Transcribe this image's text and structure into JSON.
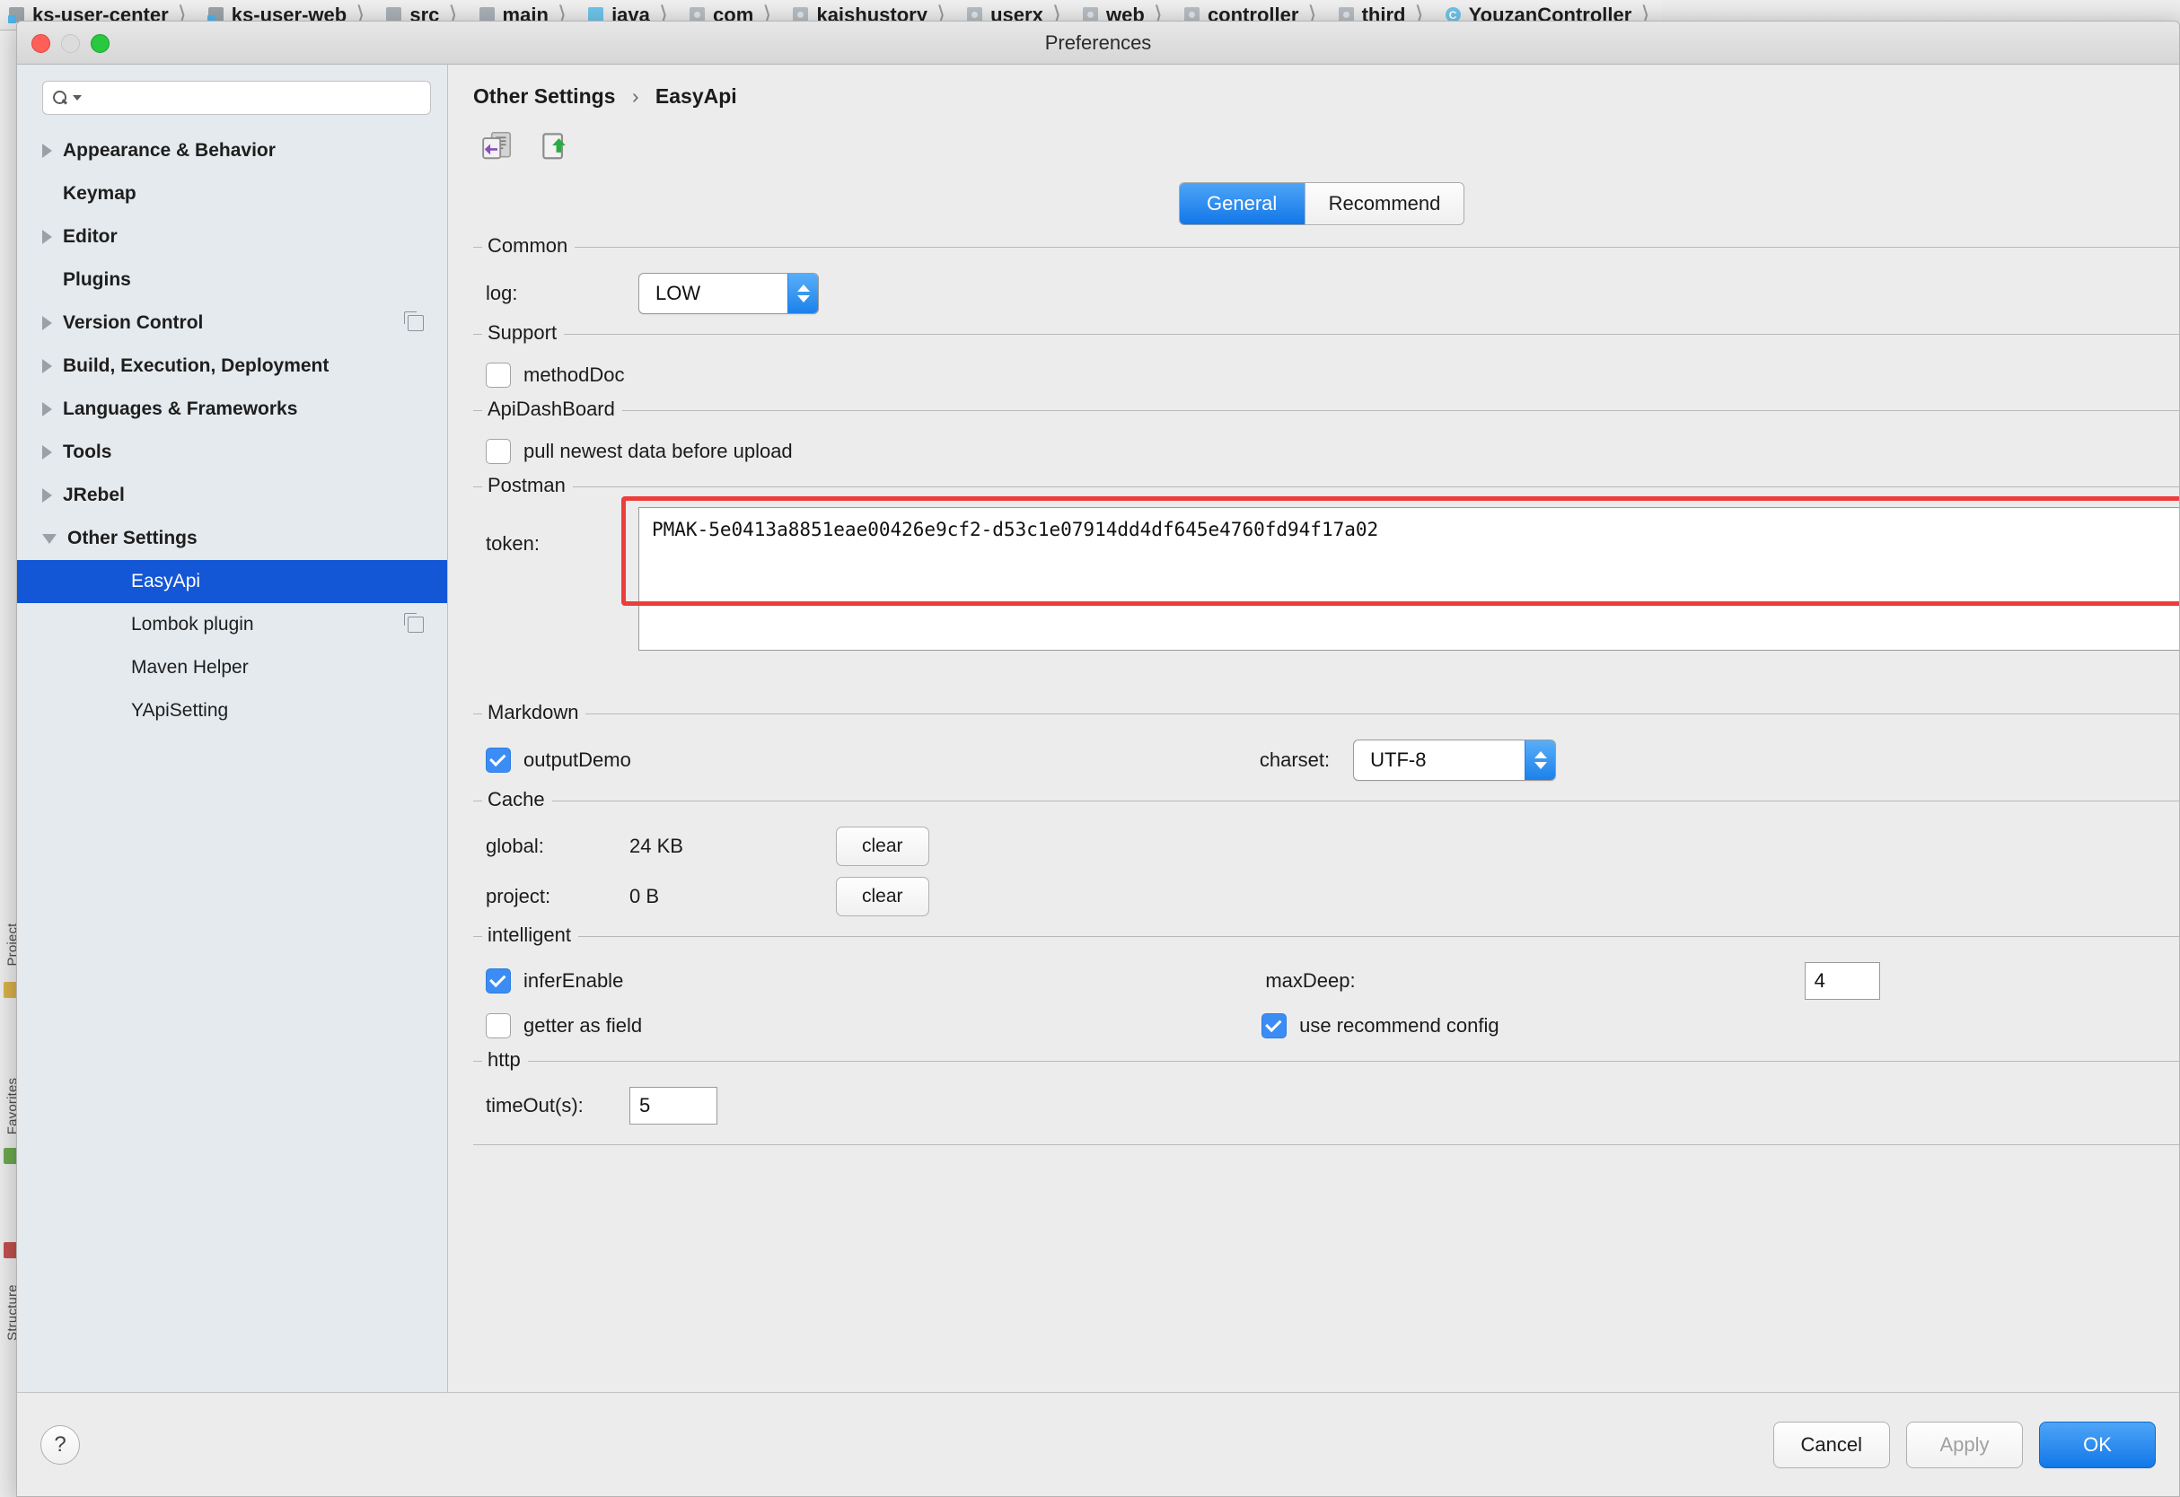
{
  "ide": {
    "breadcrumbs": [
      {
        "label": "ks-user-center",
        "icon": "project-icon"
      },
      {
        "label": "ks-user-web",
        "icon": "module-icon"
      },
      {
        "label": "src",
        "icon": "folder-icon"
      },
      {
        "label": "main",
        "icon": "folder-icon"
      },
      {
        "label": "java",
        "icon": "source-root-icon"
      },
      {
        "label": "com",
        "icon": "package-icon"
      },
      {
        "label": "kaishustory",
        "icon": "package-icon"
      },
      {
        "label": "userx",
        "icon": "package-icon"
      },
      {
        "label": "web",
        "icon": "package-icon"
      },
      {
        "label": "controller",
        "icon": "package-icon"
      },
      {
        "label": "third",
        "icon": "package-icon"
      },
      {
        "label": "YouzanController",
        "icon": "class-icon",
        "icon_glyph": "C"
      }
    ],
    "tool_strip": [
      "Project",
      "Favorites",
      "Structure"
    ]
  },
  "window": {
    "title": "Preferences",
    "traffic_lights": [
      "close-button",
      "minimize-button",
      "zoom-button"
    ]
  },
  "sidebar": {
    "search": {
      "value": "",
      "placeholder": "",
      "icon": "search-icon"
    },
    "items": [
      {
        "label": "Appearance & Behavior",
        "level": "top",
        "arrow": "collapsed",
        "selected": false,
        "badge": false
      },
      {
        "label": "Keymap",
        "level": "top",
        "arrow": "none",
        "selected": false,
        "badge": false
      },
      {
        "label": "Editor",
        "level": "top",
        "arrow": "collapsed",
        "selected": false,
        "badge": false
      },
      {
        "label": "Plugins",
        "level": "top",
        "arrow": "none",
        "selected": false,
        "badge": false
      },
      {
        "label": "Version Control",
        "level": "top",
        "arrow": "collapsed",
        "selected": false,
        "badge": true
      },
      {
        "label": "Build, Execution, Deployment",
        "level": "top",
        "arrow": "collapsed",
        "selected": false,
        "badge": false
      },
      {
        "label": "Languages & Frameworks",
        "level": "top",
        "arrow": "collapsed",
        "selected": false,
        "badge": false
      },
      {
        "label": "Tools",
        "level": "top",
        "arrow": "collapsed",
        "selected": false,
        "badge": false
      },
      {
        "label": "JRebel",
        "level": "top",
        "arrow": "collapsed",
        "selected": false,
        "badge": false
      },
      {
        "label": "Other Settings",
        "level": "top",
        "arrow": "expanded",
        "selected": false,
        "badge": false
      },
      {
        "label": "EasyApi",
        "level": "child",
        "arrow": "none",
        "selected": true,
        "badge": false
      },
      {
        "label": "Lombok plugin",
        "level": "child",
        "arrow": "none",
        "selected": false,
        "badge": true
      },
      {
        "label": "Maven Helper",
        "level": "child",
        "arrow": "none",
        "selected": false,
        "badge": false
      },
      {
        "label": "YApiSetting",
        "level": "child",
        "arrow": "none",
        "selected": false,
        "badge": false
      }
    ]
  },
  "content": {
    "breadcrumb": {
      "parent": "Other Settings",
      "separator": "›",
      "current": "EasyApi"
    },
    "toolbar": [
      {
        "name": "import-settings-button",
        "icon": "import-icon"
      },
      {
        "name": "export-settings-button",
        "icon": "export-icon"
      }
    ],
    "tabs": [
      {
        "label": "General",
        "active": true
      },
      {
        "label": "Recommend",
        "active": false
      }
    ],
    "groups": {
      "common": {
        "legend": "Common",
        "log_label": "log:",
        "log_value": "LOW"
      },
      "support": {
        "legend": "Support",
        "method_doc_label": "methodDoc",
        "method_doc_checked": false
      },
      "api_dashboard": {
        "legend": "ApiDashBoard",
        "pull_label": "pull newest data before upload",
        "pull_checked": false
      },
      "postman": {
        "legend": "Postman",
        "token_label": "token:",
        "token_value": "PMAK-5e0413a8851eae00426e9cf2-d53c1e07914dd4df645e4760fd94f17a02",
        "highlight_color": "#f03b3b"
      },
      "markdown": {
        "legend": "Markdown",
        "output_demo_label": "outputDemo",
        "output_demo_checked": true,
        "charset_label": "charset:",
        "charset_value": "UTF-8"
      },
      "cache": {
        "legend": "Cache",
        "global_label": "global:",
        "global_value": "24 KB",
        "global_clear_label": "clear",
        "project_label": "project:",
        "project_value": "0 B",
        "project_clear_label": "clear"
      },
      "intelligent": {
        "legend": "intelligent",
        "infer_enable_label": "inferEnable",
        "infer_enable_checked": true,
        "max_deep_label": "maxDeep:",
        "max_deep_value": "4",
        "getter_as_field_label": "getter as field",
        "getter_as_field_checked": false,
        "use_recommend_label": "use recommend config",
        "use_recommend_checked": true
      },
      "http": {
        "legend": "http",
        "timeout_label": "timeOut(s):",
        "timeout_value": "5"
      }
    }
  },
  "footer": {
    "help_label": "?",
    "cancel_label": "Cancel",
    "apply_label": "Apply",
    "ok_label": "OK"
  },
  "colors": {
    "accent_blue": "#1277e8",
    "selection_blue": "#1356d6",
    "highlight_red": "#f03b3b",
    "dialog_bg": "#ececec",
    "sidebar_bg": "#e5eaee"
  }
}
